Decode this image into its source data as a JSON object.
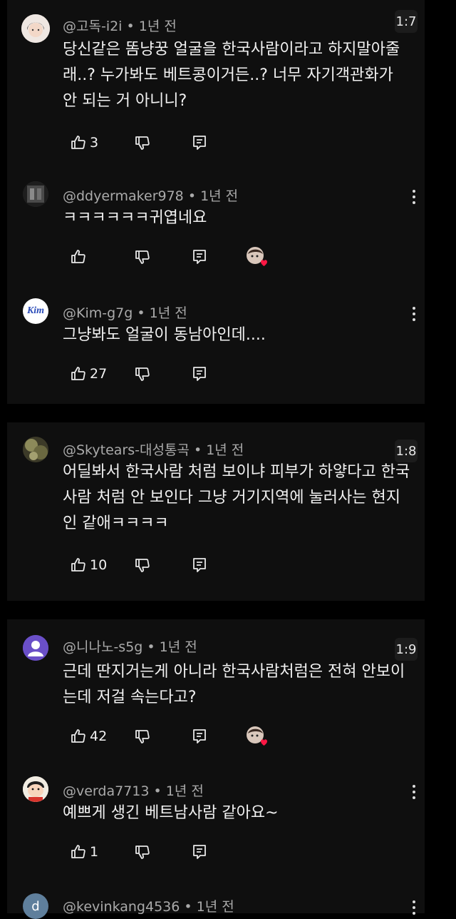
{
  "threads": [
    {
      "page_badge": "1:7",
      "comments": [
        {
          "author": "@고독-i2i",
          "age": "1년 전",
          "text": "당신같은 똠냥꿍 얼굴을 한국사람이라고 하지말아줄래..? 누가봐도 베트콩이거든..? 너무 자기객관화가 안 되는 거 아니니?",
          "likes": "3"
        },
        {
          "author": "@ddyermaker978",
          "age": "1년 전",
          "text": "ㅋㅋㅋㅋㅋㅋ귀엽네요",
          "likes": ""
        },
        {
          "author": "@Kim-g7g",
          "age": "1년 전",
          "avatar_label": "Kim",
          "text": "그냥봐도 얼굴이 동남아인데....",
          "likes": "27"
        }
      ]
    },
    {
      "page_badge": "1:8",
      "comments": [
        {
          "author": "@Skytears-대성통곡",
          "age": "1년 전",
          "text": "어딜봐서 한국사람 처럼 보이냐 피부가 하얗다고 한국사람 처럼 안 보인다 그냥 거기지역에 눌러사는 현지인 같애ㅋㅋㅋㅋ",
          "likes": "10"
        }
      ]
    },
    {
      "page_badge": "1:9",
      "comments": [
        {
          "author": "@니나노-s5g",
          "age": "1년 전",
          "text": "근데 딴지거는게 아니라 한국사람처럼은 전혀 안보이는데 저걸 속는다고?",
          "likes": "42"
        },
        {
          "author": "@verda7713",
          "age": "1년 전",
          "text": "예쁘게 생긴 베트남사람 같아요~",
          "likes": "1"
        },
        {
          "author": "@kevinkang4536",
          "age": "1년 전",
          "avatar_label": "d"
        }
      ]
    }
  ],
  "colors": {
    "background": "#000000",
    "panel": "#0f0f0f",
    "text": "#f1f1f1",
    "meta": "#aaaaaa",
    "heart": "#ff1744",
    "purple_avatar": "#6a4fc8",
    "kevin_avatar": "#5f7f9c"
  },
  "icons": [
    "thumbs-up-icon",
    "thumbs-down-icon",
    "reply-icon",
    "kebab-menu-icon",
    "creator-heart-icon"
  ]
}
